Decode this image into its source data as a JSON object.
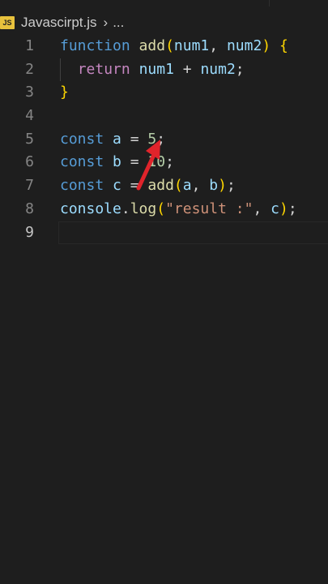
{
  "breadcrumb": {
    "icon_label": "JS",
    "file": "Javascirpt.js",
    "more": "..."
  },
  "editor": {
    "active_line": 9,
    "lines": [
      {
        "number": "1",
        "tokens": [
          {
            "t": "function",
            "c": "kw"
          },
          {
            "t": " ",
            "c": "plain"
          },
          {
            "t": "add",
            "c": "fn"
          },
          {
            "t": "(",
            "c": "brace"
          },
          {
            "t": "num1",
            "c": "var"
          },
          {
            "t": ", ",
            "c": "plain"
          },
          {
            "t": "num2",
            "c": "var"
          },
          {
            "t": ")",
            "c": "brace"
          },
          {
            "t": " ",
            "c": "plain"
          },
          {
            "t": "{",
            "c": "brace"
          }
        ]
      },
      {
        "number": "2",
        "tokens": [
          {
            "t": "  ",
            "c": "plain"
          },
          {
            "t": "return",
            "c": "kw-ctrl"
          },
          {
            "t": " ",
            "c": "plain"
          },
          {
            "t": "num1",
            "c": "var"
          },
          {
            "t": " + ",
            "c": "plain"
          },
          {
            "t": "num2",
            "c": "var"
          },
          {
            "t": ";",
            "c": "plain"
          }
        ]
      },
      {
        "number": "3",
        "tokens": [
          {
            "t": "}",
            "c": "brace"
          }
        ]
      },
      {
        "number": "4",
        "tokens": []
      },
      {
        "number": "5",
        "tokens": [
          {
            "t": "const",
            "c": "kw"
          },
          {
            "t": " ",
            "c": "plain"
          },
          {
            "t": "a",
            "c": "var"
          },
          {
            "t": " = ",
            "c": "plain"
          },
          {
            "t": "5",
            "c": "num"
          },
          {
            "t": ";",
            "c": "plain"
          }
        ]
      },
      {
        "number": "6",
        "tokens": [
          {
            "t": "const",
            "c": "kw"
          },
          {
            "t": " ",
            "c": "plain"
          },
          {
            "t": "b",
            "c": "var"
          },
          {
            "t": " = ",
            "c": "plain"
          },
          {
            "t": "10",
            "c": "num"
          },
          {
            "t": ";",
            "c": "plain"
          }
        ]
      },
      {
        "number": "7",
        "tokens": [
          {
            "t": "const",
            "c": "kw"
          },
          {
            "t": " ",
            "c": "plain"
          },
          {
            "t": "c",
            "c": "var"
          },
          {
            "t": " = ",
            "c": "plain"
          },
          {
            "t": "add",
            "c": "fn"
          },
          {
            "t": "(",
            "c": "brace"
          },
          {
            "t": "a",
            "c": "var"
          },
          {
            "t": ", ",
            "c": "plain"
          },
          {
            "t": "b",
            "c": "var"
          },
          {
            "t": ")",
            "c": "brace"
          },
          {
            "t": ";",
            "c": "plain"
          }
        ]
      },
      {
        "number": "8",
        "tokens": [
          {
            "t": "console",
            "c": "var"
          },
          {
            "t": ".",
            "c": "plain"
          },
          {
            "t": "log",
            "c": "fn"
          },
          {
            "t": "(",
            "c": "brace"
          },
          {
            "t": "\"result :\"",
            "c": "str"
          },
          {
            "t": ", ",
            "c": "plain"
          },
          {
            "t": "c",
            "c": "var"
          },
          {
            "t": ")",
            "c": "brace"
          },
          {
            "t": ";",
            "c": "plain"
          }
        ]
      },
      {
        "number": "9",
        "tokens": []
      }
    ]
  },
  "annotation": {
    "icon": "red-arrow-icon",
    "color": "#e0242b"
  },
  "colors": {
    "background": "#1e1e1e",
    "keyword": "#569cd6",
    "control_keyword": "#c586c0",
    "function": "#dcdcaa",
    "variable": "#9cdcfe",
    "number": "#b5cea8",
    "string": "#ce9178",
    "bracket": "#ffd700"
  }
}
